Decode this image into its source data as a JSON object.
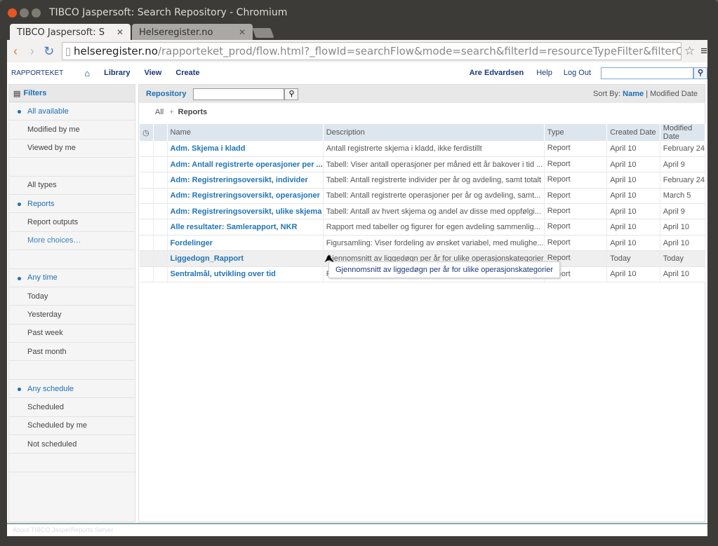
{
  "window": {
    "title": "TIBCO Jaspersoft: Search Repository - Chromium"
  },
  "tabs": [
    {
      "label": "TIBCO Jaspersoft: S"
    },
    {
      "label": "Helseregister.no"
    }
  ],
  "url": {
    "host": "helseregister.no",
    "path": "/rapporteket_prod/flow.html?_flowId=searchFlow&mode=search&filterId=resourceTypeFilter&filterOption=resource"
  },
  "header": {
    "logo": "RAPPORTEKET",
    "nav": [
      "Library",
      "View",
      "Create"
    ],
    "user": "Are Edvardsen",
    "help": "Help",
    "logout": "Log Out"
  },
  "sidebar": {
    "title": "Filters",
    "rows": [
      {
        "label": "All available",
        "state": "selected"
      },
      {
        "label": "Modified by me"
      },
      {
        "label": "Viewed by me"
      },
      {
        "label": ""
      },
      {
        "label": "All types"
      },
      {
        "label": "Reports",
        "state": "selected"
      },
      {
        "label": "Report outputs"
      },
      {
        "label": "More choices…",
        "state": "link"
      },
      {
        "label": ""
      },
      {
        "label": "Any time",
        "state": "selected"
      },
      {
        "label": "Today"
      },
      {
        "label": "Yesterday"
      },
      {
        "label": "Past week"
      },
      {
        "label": "Past month"
      },
      {
        "label": ""
      },
      {
        "label": "Any schedule",
        "state": "selected"
      },
      {
        "label": "Scheduled"
      },
      {
        "label": "Scheduled by me"
      },
      {
        "label": "Not scheduled"
      },
      {
        "label": ""
      }
    ]
  },
  "main": {
    "repository": "Repository",
    "sort_label": "Sort By:",
    "sort_name": "Name",
    "sort_modified": "Modified Date",
    "breadcrumb": {
      "all": "All",
      "current": "Reports"
    },
    "columns": [
      "Name",
      "Description",
      "Type",
      "Created Date",
      "Modified Date"
    ],
    "rows": [
      [
        "Adm. Skjema i kladd",
        "Antall registrerte skjema i kladd, ikke ferdistillt",
        "Report",
        "April 10",
        "February 24"
      ],
      [
        "Adm: Antall registrerte operasjoner per ...",
        "Tabell: Viser antall operasjoner per måned ett år bakover i tid ...",
        "Report",
        "April 10",
        "April 9"
      ],
      [
        "Adm: Registreringsoversikt, individer",
        "Tabell: Antall registrerte individer per år og avdeling, samt totalt",
        "Report",
        "April 10",
        "February 24"
      ],
      [
        "Adm: Registreringsoversikt, operasjoner",
        "Tabell: Antall registrerte operasjoner per år og avdeling, samt...",
        "Report",
        "April 10",
        "March 5"
      ],
      [
        "Adm: Registreringsoversikt, ulike skjema",
        "Tabell: Antall av hvert skjema og andel av disse med oppfølgi...",
        "Report",
        "April 10",
        "April 9"
      ],
      [
        "Alle resultater: Samlerapport, NKR",
        "Rapport med tabeller og figurer for egen avdeling sammenlig...",
        "Report",
        "April 10",
        "April 10"
      ],
      [
        "Fordelinger",
        "Figursamling: Viser fordeling av ønsket variabel, med mulighe...",
        "Report",
        "April 10",
        "April 10"
      ],
      [
        "Liggedogn_Rapport",
        "Gjennomsnitt av liggedøgn per år for ulike operasjonskategorier",
        "Report",
        "Today",
        "Today"
      ],
      [
        "Sentralmål, utvikling over tid",
        "Fig",
        "Report",
        "April 10",
        "April 10"
      ]
    ],
    "tooltip": "Gjennomsnitt av liggedøgn per år for ulike operasjonskategorier"
  },
  "footer": "About TIBCO JasperReports Server"
}
